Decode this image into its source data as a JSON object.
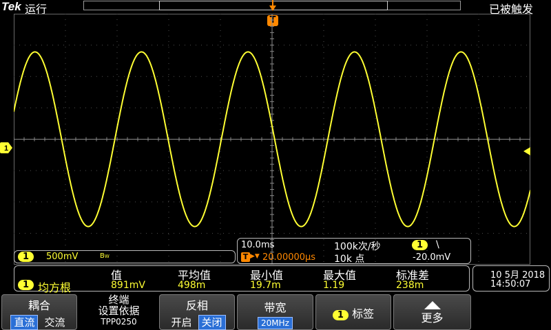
{
  "top": {
    "brand": "Tek",
    "run_status": "运行",
    "trigger_status": "已被触发",
    "trigger_marker": "T"
  },
  "channel1": {
    "marker": "1",
    "scale": "500mV",
    "bandwidth_flag": "B",
    "bandwidth_flag_sub": "W",
    "color": "#ffff33"
  },
  "waveform": {
    "type": "sine",
    "cycles_on_screen": 4.85
  },
  "horizontal": {
    "timebase": "10.0ms",
    "sample_rate": "100k次/秒",
    "record_length": "10k 点",
    "position_marker": "T",
    "position_arrow": "▶▼",
    "position": "20.00000µs",
    "trigger_channel": "1",
    "trigger_slope": "\\",
    "trigger_level": "-20.0mV"
  },
  "measurements": {
    "headers": [
      "值",
      "平均值",
      "最小值",
      "最大值",
      "标准差"
    ],
    "row": {
      "channel": "1",
      "name": "均方根",
      "values": [
        "891mV",
        "498m",
        "19.7m",
        "1.19",
        "238m"
      ]
    }
  },
  "datetime": {
    "date": "10 5月 2018",
    "time": "14:50:07"
  },
  "menu": {
    "coupling": {
      "title": "耦合",
      "opt_dc": "直流",
      "opt_ac": "交流",
      "selected": "直流"
    },
    "termination": {
      "title": "终端",
      "subtitle": "设置依据",
      "probe": "TPP0250"
    },
    "invert": {
      "title": "反相",
      "opt_on": "开启",
      "opt_off": "关闭",
      "selected": "关闭"
    },
    "bandwidth": {
      "title": "带宽",
      "value": "20MHz"
    },
    "label": {
      "channel": "1",
      "title": "标签"
    },
    "more": {
      "title": "更多",
      "icon": "triangle-up-icon"
    }
  }
}
